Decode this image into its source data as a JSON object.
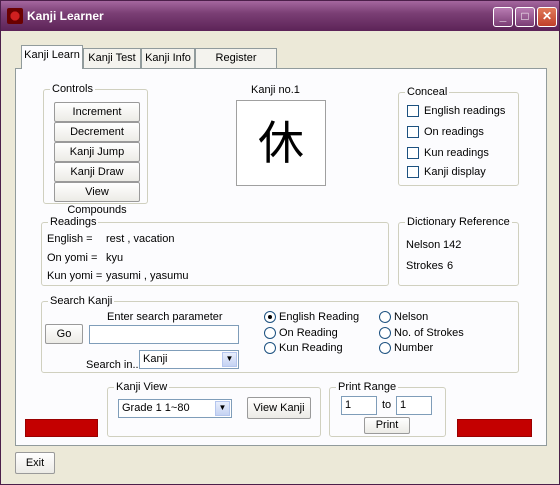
{
  "window": {
    "title": "Kanji Learner",
    "minimize": "_",
    "maximize": "□",
    "close": "✕"
  },
  "tabs": [
    "Kanji Learn",
    "Kanji Test",
    "Kanji Info",
    "Register"
  ],
  "controls": {
    "legend": "Controls",
    "buttons": [
      "Increment",
      "Decrement",
      "Kanji Jump",
      "Kanji Draw",
      "View Compounds"
    ]
  },
  "kanji": {
    "label": "Kanji no.1",
    "character": "休"
  },
  "conceal": {
    "legend": "Conceal",
    "options": [
      "English readings",
      "On readings",
      "Kun readings",
      "Kanji display"
    ]
  },
  "readings": {
    "legend": "Readings",
    "rows": [
      {
        "label": "English =",
        "value": "rest , vacation"
      },
      {
        "label": "On yomi =",
        "value": "kyu"
      },
      {
        "label": "Kun yomi =",
        "value": "yasumi , yasumu"
      }
    ]
  },
  "dictionary": {
    "legend": "Dictionary Reference",
    "nelson_label": "Nelson",
    "nelson_value": "142",
    "strokes_label": "Strokes",
    "strokes_value": "6"
  },
  "search": {
    "legend": "Search Kanji",
    "prompt": "Enter search parameter",
    "go_label": "Go",
    "input_value": "",
    "search_in_label": "Search in...",
    "search_in_value": "Kanji",
    "radios_left": [
      {
        "label": "English Reading",
        "selected": true
      },
      {
        "label": "On Reading",
        "selected": false
      },
      {
        "label": "Kun Reading",
        "selected": false
      }
    ],
    "radios_right": [
      {
        "label": "Nelson",
        "selected": false
      },
      {
        "label": "No. of Strokes",
        "selected": false
      },
      {
        "label": "Number",
        "selected": false
      }
    ]
  },
  "kanji_view": {
    "legend": "Kanji View",
    "grade_value": "Grade 1   1~80",
    "view_label": "View Kanji"
  },
  "print_range": {
    "legend": "Print Range",
    "from": "1",
    "to_label": "to",
    "to": "1",
    "print_label": "Print"
  },
  "footer": {
    "exit_label": "Exit"
  },
  "colors": {
    "titlebar": "#7b3f75",
    "status_bar": "#c40000"
  }
}
